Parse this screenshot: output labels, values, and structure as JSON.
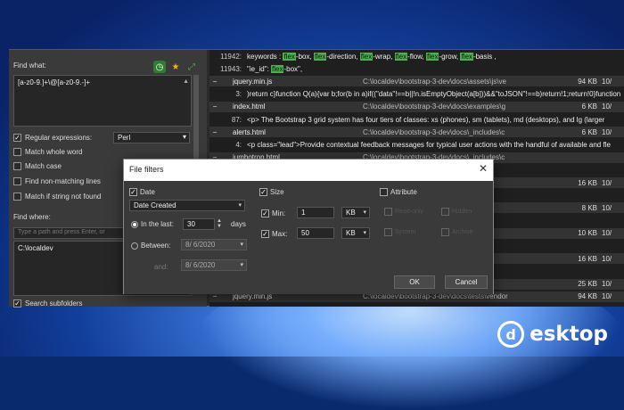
{
  "left": {
    "find_what_label": "Find what:",
    "regex_text": "[a-z0-9.]+\\@[a-z0-9.-]+",
    "options": [
      {
        "label": "Regular expressions:",
        "checked": true
      },
      {
        "label": "Match whole word",
        "checked": false
      },
      {
        "label": "Match case",
        "checked": false
      },
      {
        "label": "Find non-matching lines",
        "checked": false
      },
      {
        "label": "Match if string not found",
        "checked": false
      }
    ],
    "regex_engine": "Perl",
    "find_where_label": "Find where:",
    "where_placeholder": "Type a path and press Enter, or",
    "where_paths": [
      "C:\\localdev"
    ],
    "bottom_option": "Search subfolders"
  },
  "results": {
    "rows": [
      {
        "kind": "match",
        "line": "11942:",
        "text": "keywords : flex-box, flex-direction, flex-wrap, flex-flow, flex-grow, flex-basis ,"
      },
      {
        "kind": "match",
        "line": "11943:",
        "text": "\"ie_id\": flex-box\","
      },
      {
        "kind": "file",
        "name": "jquery.min.js",
        "path": "C:\\localdev\\bootstrap-3-dev\\docs\\assets\\js\\ve",
        "size": "94 KB",
        "date": "10/"
      },
      {
        "kind": "match",
        "line": "3:",
        "text": ")return c}function Q(a){var b;for(b in a)if((\"data\"!==b||!n.isEmptyObject(a[b]))&&\"toJSON\"!==b)return!1;return!0}function"
      },
      {
        "kind": "file",
        "name": "index.html",
        "path": "C:\\localdev\\bootstrap-3-dev\\docs\\examples\\g",
        "size": "6 KB",
        "date": "10/"
      },
      {
        "kind": "match",
        "line": "87:",
        "text": "<p> The Bootstrap 3 grid system has four tiers of classes: xs (phones), sm (tablets), md (desktops), and lg (larger"
      },
      {
        "kind": "file",
        "name": "alerts.html",
        "path": "C:\\localdev\\bootstrap-3-dev\\docs\\_includes\\c",
        "size": "6 KB",
        "date": "10/"
      },
      {
        "kind": "match",
        "line": "4:",
        "text": "<p class=\"lead\">Provide contextual feedback messages for typical user actions with the handful of available and fle"
      },
      {
        "kind": "file",
        "name": "jumbotron.html",
        "path": "C:\\localdev\\bootstrap-3-dev\\docs\\_includes\\c",
        "size": "",
        "date": ""
      },
      {
        "kind": "match",
        "line": "",
        "text": "ewport to showcase key content on yo"
      },
      {
        "kind": "file",
        "name": "",
        "path": "c",
        "size": "16 KB",
        "date": "10/"
      },
      {
        "kind": "match",
        "line": "",
        "text": "ying not only simple lists of elements,"
      },
      {
        "kind": "file",
        "name": "",
        "path": "c",
        "size": "8 KB",
        "date": "10/"
      },
      {
        "kind": "match",
        "line": "",
        "text": "r action with simple yet flexible progr"
      },
      {
        "kind": "file",
        "name": "",
        "path": "c",
        "size": "10 KB",
        "date": "10/"
      },
      {
        "kind": "match",
        "line": "",
        "text": "specify a separate delay and duration"
      },
      {
        "kind": "file",
        "name": "",
        "path": "c",
        "size": "16 KB",
        "date": "10/"
      },
      {
        "kind": "match",
        "line": "",
        "text": "le behavior.</p>"
      },
      {
        "kind": "file",
        "name": "",
        "path": "c",
        "size": "25 KB",
        "date": "10/"
      },
      {
        "kind": "file",
        "name": "jquery.min.js",
        "path": "C:\\localdev\\bootstrap-3-dev\\docs\\tests\\vendor",
        "size": "94 KB",
        "date": "10/"
      }
    ]
  },
  "dialog": {
    "title": "File filters",
    "close": "✕",
    "date_label": "Date",
    "date_checked": true,
    "date_type": "Date Created",
    "in_last_label": "In the last:",
    "in_last_value": "30",
    "in_last_unit": "days",
    "between_label": "Between:",
    "between_from": "8/ 6/2020",
    "and_label": "and:",
    "between_to": "8/ 6/2020",
    "size_label": "Size",
    "size_checked": true,
    "min_label": "Min:",
    "min_value": "1",
    "min_unit": "KB",
    "max_label": "Max:",
    "max_value": "50",
    "max_unit": "KB",
    "attribute_label": "Attribute",
    "attributes": [
      "Read-only",
      "Hidden",
      "System",
      "Archive"
    ],
    "ok": "OK",
    "cancel": "Cancel"
  },
  "watermark": {
    "text": "esktop",
    "logo_letter": "d"
  }
}
